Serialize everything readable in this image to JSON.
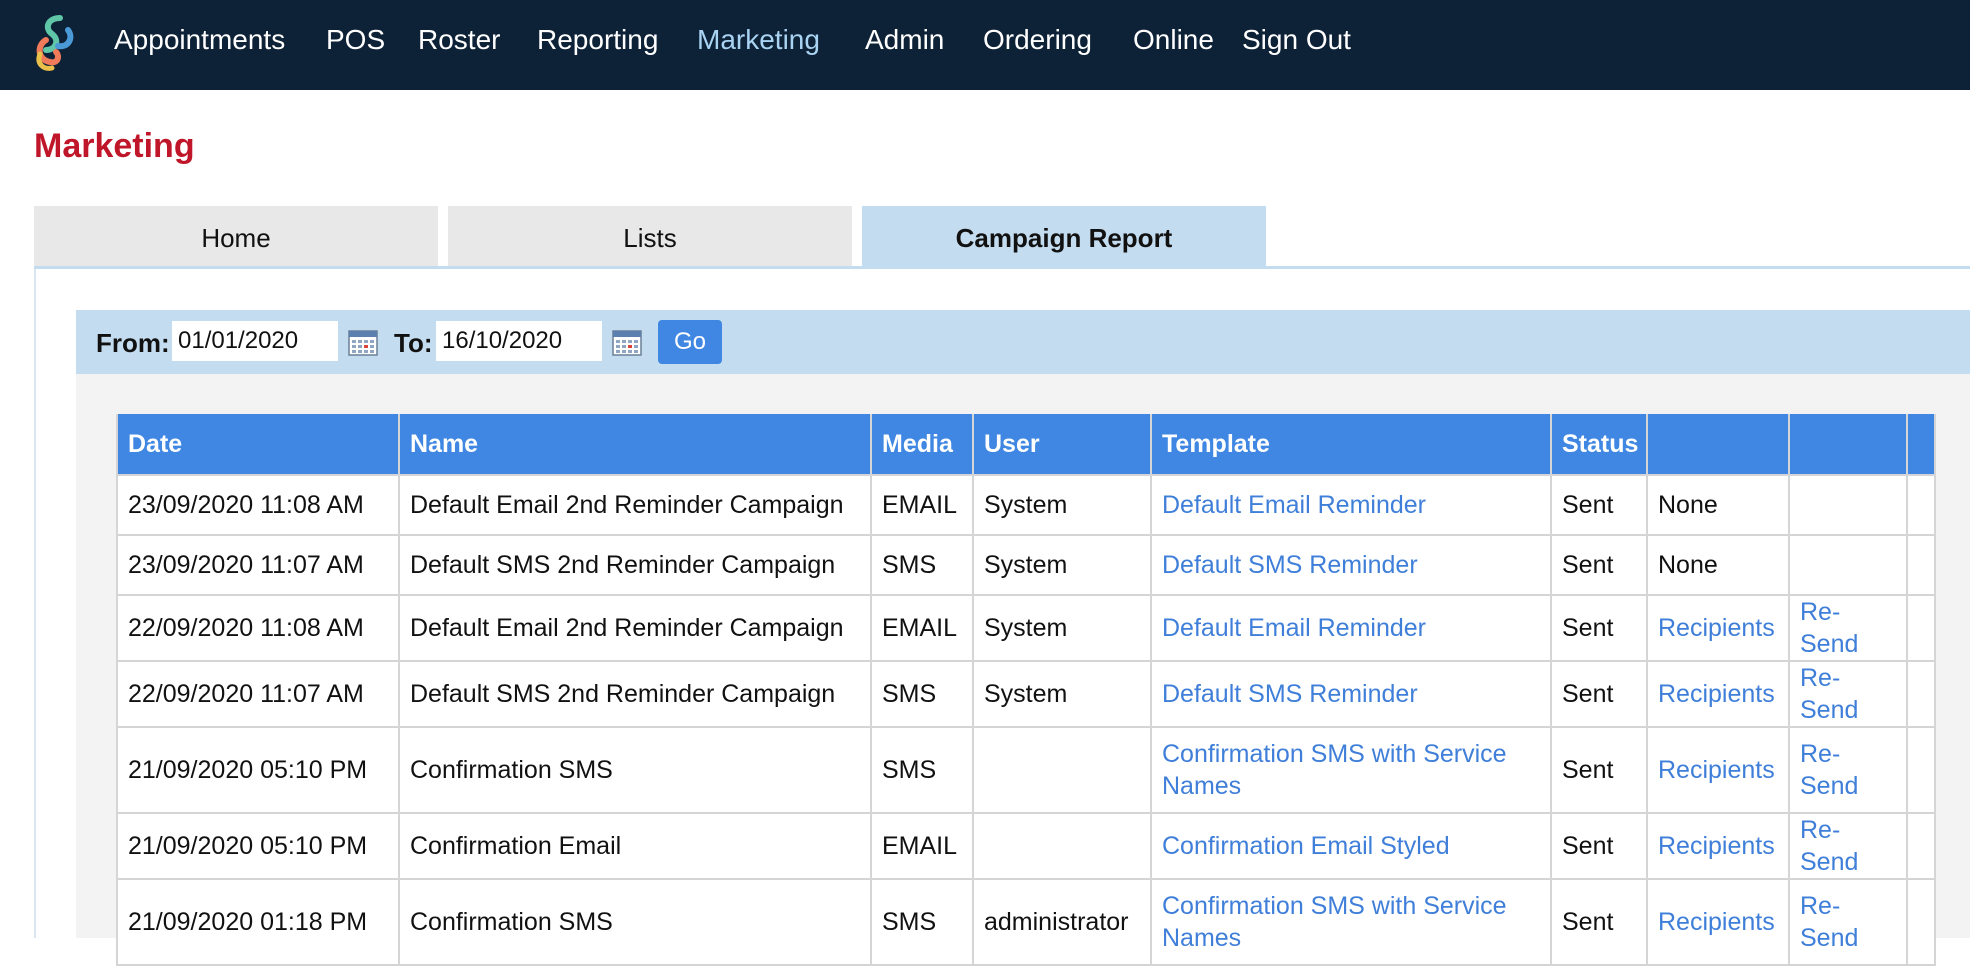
{
  "nav": {
    "items": [
      {
        "label": "Appointments",
        "active": false
      },
      {
        "label": "POS",
        "active": false
      },
      {
        "label": "Roster",
        "active": false
      },
      {
        "label": "Reporting",
        "active": false
      },
      {
        "label": "Marketing",
        "active": true
      },
      {
        "label": "Admin",
        "active": false
      },
      {
        "label": "Ordering",
        "active": false
      },
      {
        "label": "Online",
        "active": false
      },
      {
        "label": "Sign Out",
        "active": false
      }
    ],
    "active_color": "#a9d3f2",
    "background": "#0e2237"
  },
  "page": {
    "title": "Marketing",
    "title_color": "#c0162a"
  },
  "tabs": [
    {
      "label": "Home",
      "active": false
    },
    {
      "label": "Lists",
      "active": false
    },
    {
      "label": "Campaign Report",
      "active": true
    }
  ],
  "filter": {
    "from_label": "From:",
    "from_value": "01/01/2020",
    "to_label": "To:",
    "to_value": "16/10/2020",
    "go_label": "Go"
  },
  "table": {
    "headers": [
      "Date",
      "Name",
      "Media",
      "User",
      "Template",
      "Status",
      "",
      "",
      ""
    ],
    "rows": [
      {
        "date": "23/09/2020 11:08 AM",
        "name": "Default Email 2nd Reminder Campaign",
        "media": "EMAIL",
        "user": "System",
        "template": "Default Email Reminder",
        "status": "Sent",
        "recipients": "None",
        "resend": ""
      },
      {
        "date": "23/09/2020 11:07 AM",
        "name": "Default SMS 2nd Reminder Campaign",
        "media": "SMS",
        "user": "System",
        "template": "Default SMS Reminder",
        "status": "Sent",
        "recipients": "None",
        "resend": ""
      },
      {
        "date": "22/09/2020 11:08 AM",
        "name": "Default Email 2nd Reminder Campaign",
        "media": "EMAIL",
        "user": "System",
        "template": "Default Email Reminder",
        "status": "Sent",
        "recipients": "Recipients",
        "resend": "Re-Send"
      },
      {
        "date": "22/09/2020 11:07 AM",
        "name": "Default SMS 2nd Reminder Campaign",
        "media": "SMS",
        "user": "System",
        "template": "Default SMS Reminder",
        "status": "Sent",
        "recipients": "Recipients",
        "resend": "Re-Send"
      },
      {
        "date": "21/09/2020 05:10 PM",
        "name": "Confirmation SMS",
        "media": "SMS",
        "user": "",
        "template": "Confirmation SMS with Service Names",
        "status": "Sent",
        "recipients": "Recipients",
        "resend": "Re-Send"
      },
      {
        "date": "21/09/2020 05:10 PM",
        "name": "Confirmation Email",
        "media": "EMAIL",
        "user": "",
        "template": "Confirmation Email Styled",
        "status": "Sent",
        "recipients": "Recipients",
        "resend": "Re-Send"
      },
      {
        "date": "21/09/2020 01:18 PM",
        "name": "Confirmation SMS",
        "media": "SMS",
        "user": "administrator",
        "template": "Confirmation SMS with Service Names",
        "status": "Sent",
        "recipients": "Recipients",
        "resend": "Re-Send"
      }
    ],
    "header_color": "#3f87e2",
    "link_color": "#3f7fd9"
  }
}
